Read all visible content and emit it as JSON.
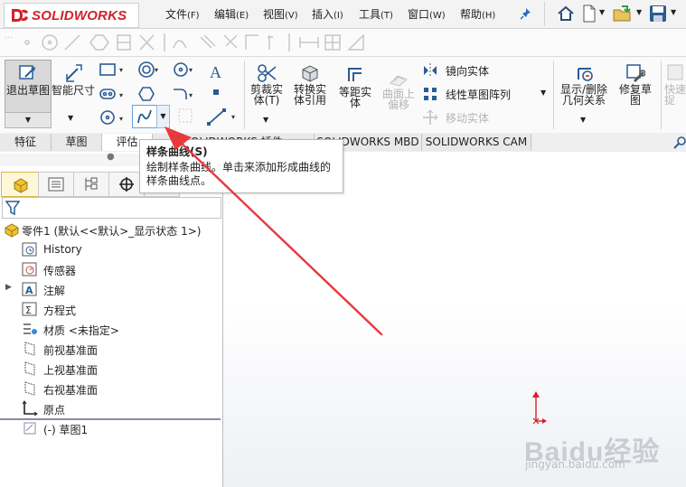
{
  "app": {
    "logo": "SOLIDWORKS"
  },
  "menu": {
    "items": [
      {
        "label": "文件",
        "key": "(F)"
      },
      {
        "label": "编辑",
        "key": "(E)"
      },
      {
        "label": "视图",
        "key": "(V)"
      },
      {
        "label": "插入",
        "key": "(I)"
      },
      {
        "label": "工具",
        "key": "(T)"
      },
      {
        "label": "窗口",
        "key": "(W)"
      },
      {
        "label": "帮助",
        "key": "(H)"
      }
    ]
  },
  "ribbon": {
    "exit_sketch": "退出草图",
    "smart_dimension": "智能尺寸",
    "trim": "剪裁实体",
    "trim_key": "(T)",
    "convert": "转换实体引用",
    "offset": "等距实体",
    "offset_surface": "曲面上偏移",
    "mirror": "镜向实体",
    "linear_pattern": "线性草图阵列",
    "move": "移动实体",
    "display_delete": "显示/删除几何关系",
    "repair": "修复草图",
    "quick_snaps": "快速捕捉"
  },
  "tabs": [
    "特征",
    "草图",
    "评估",
    "SOLIDWORKS 插件",
    "SOLIDWORKS MBD",
    "SOLIDWORKS CAM"
  ],
  "tooltip": {
    "title": "样条曲线(S)",
    "description": "绘制样条曲线。单击来添加形成曲线的样条曲线点。"
  },
  "tree": {
    "root": "零件1 (默认<<默认>_显示状态 1>)",
    "items": [
      "History",
      "传感器",
      "注解",
      "方程式",
      "材质 <未指定>",
      "前视基准面",
      "上视基准面",
      "右视基准面",
      "原点",
      "(-) 草图1"
    ]
  },
  "watermark": {
    "logo": "Baidu经验",
    "url": "jingyan.baidu.com"
  },
  "colors": {
    "brand_red": "#d4212a",
    "arrow_red": "#e8393d",
    "tab_active": "#ffffff"
  }
}
